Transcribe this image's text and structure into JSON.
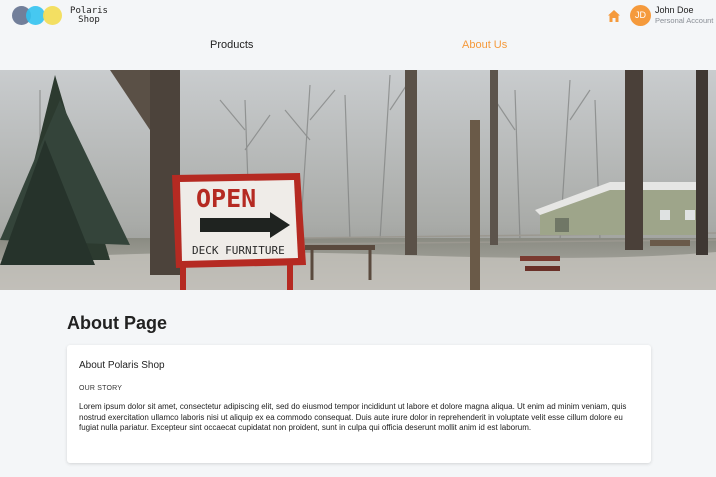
{
  "brand": {
    "line1": "Polaris",
    "line2": "Shop"
  },
  "user": {
    "initials": "JD",
    "name": "John Doe",
    "subtitle": "Personal Account"
  },
  "nav": {
    "items": [
      {
        "label": "Products"
      },
      {
        "label": "About Us"
      }
    ],
    "active_color": "#f59a3c"
  },
  "hero": {
    "sign_top": "OPEN",
    "sign_bottom": "DECK FURNITURE"
  },
  "page": {
    "title": "About Page"
  },
  "card": {
    "title": "About Polaris Shop",
    "section": "OUR STORY",
    "body": "Lorem ipsum dolor sit amet, consectetur adipiscing elit, sed do eiusmod tempor incididunt ut labore et dolore magna aliqua. Ut enim ad minim veniam, quis nostrud exercitation ullamco laboris nisi ut aliquip ex ea commodo consequat. Duis aute irure dolor in reprehenderit in voluptate velit esse cillum dolore eu fugiat nulla pariatur. Excepteur sint occaecat cupidatat non proident, sunt in culpa qui officia deserunt mollit anim id est laborum."
  },
  "colors": {
    "accent": "#f59a3c",
    "background": "#f4f6f8"
  },
  "icons": {
    "home": "home-icon"
  }
}
